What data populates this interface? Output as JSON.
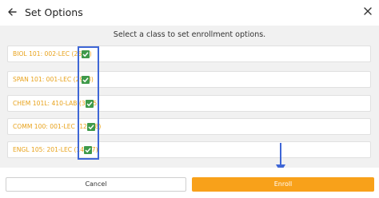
{
  "header": {
    "title": "Set Options",
    "back_icon": "arrow-left-icon",
    "close_icon": "close-icon"
  },
  "content": {
    "instruction": "Select a class to set enrollment options.",
    "classes": [
      {
        "label": "BIOL 101: 002-LEC (2648)",
        "checked": true
      },
      {
        "label": "SPAN 101: 001-LEC (2928)",
        "checked": true
      },
      {
        "label": "CHEM 101L: 410-LAB (3975)",
        "checked": true
      },
      {
        "label": "COMM 100: 001-LEC (12058)",
        "checked": true
      },
      {
        "label": "ENGL 105: 201-LEC (14477)",
        "checked": true
      }
    ]
  },
  "footer": {
    "cancel_label": "Cancel",
    "enroll_label": "Enroll"
  },
  "colors": {
    "accent": "#f8a11a",
    "class_label": "#e8a21b",
    "checkbox": "#3f9a4a",
    "annotation": "#3e66d6"
  }
}
